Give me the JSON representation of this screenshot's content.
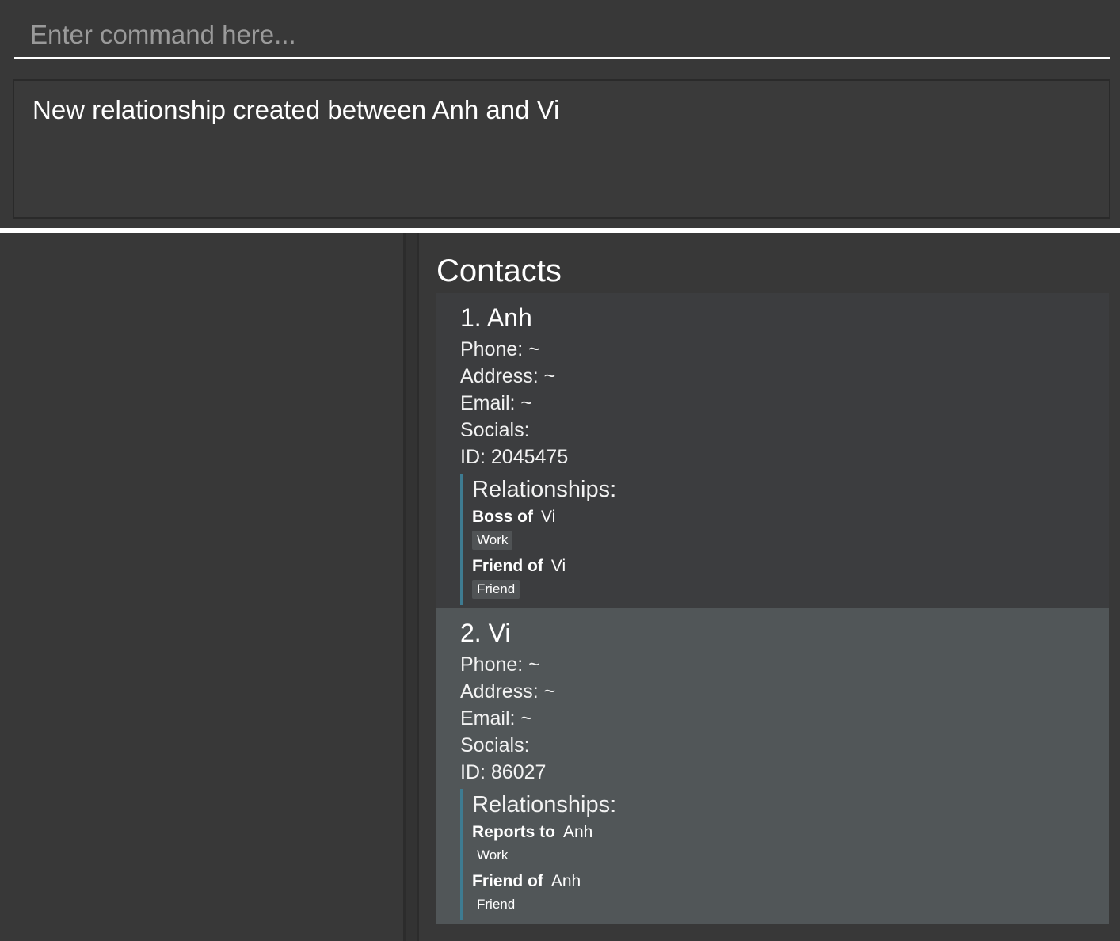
{
  "command_box": {
    "placeholder": "Enter command here...",
    "value": ""
  },
  "result_display": {
    "text": "New relationship created between Anh and Vi"
  },
  "contacts_panel": {
    "title": "Contacts",
    "contacts": [
      {
        "name": "1. Anh",
        "phone": "Phone: ~",
        "address": "Address: ~",
        "email": "Email: ~",
        "socials": "Socials:",
        "id": "ID: 2045475",
        "relationships_title": "Relationships:",
        "relationships": [
          {
            "type": "Boss of",
            "target": "Vi",
            "tag": "Work"
          },
          {
            "type": "Friend of",
            "target": "Vi",
            "tag": "Friend"
          }
        ]
      },
      {
        "name": "2. Vi",
        "phone": "Phone: ~",
        "address": "Address: ~",
        "email": "Email: ~",
        "socials": "Socials:",
        "id": "ID: 86027",
        "relationships_title": "Relationships:",
        "relationships": [
          {
            "type": "Reports to",
            "target": "Anh",
            "tag": "Work"
          },
          {
            "type": "Friend of",
            "target": "Anh",
            "tag": "Friend"
          }
        ]
      }
    ]
  },
  "colors": {
    "background": "#383838",
    "card_normal": "#3c3d3f",
    "card_selected": "#515658",
    "relationship_accent": "#3e7b91"
  }
}
